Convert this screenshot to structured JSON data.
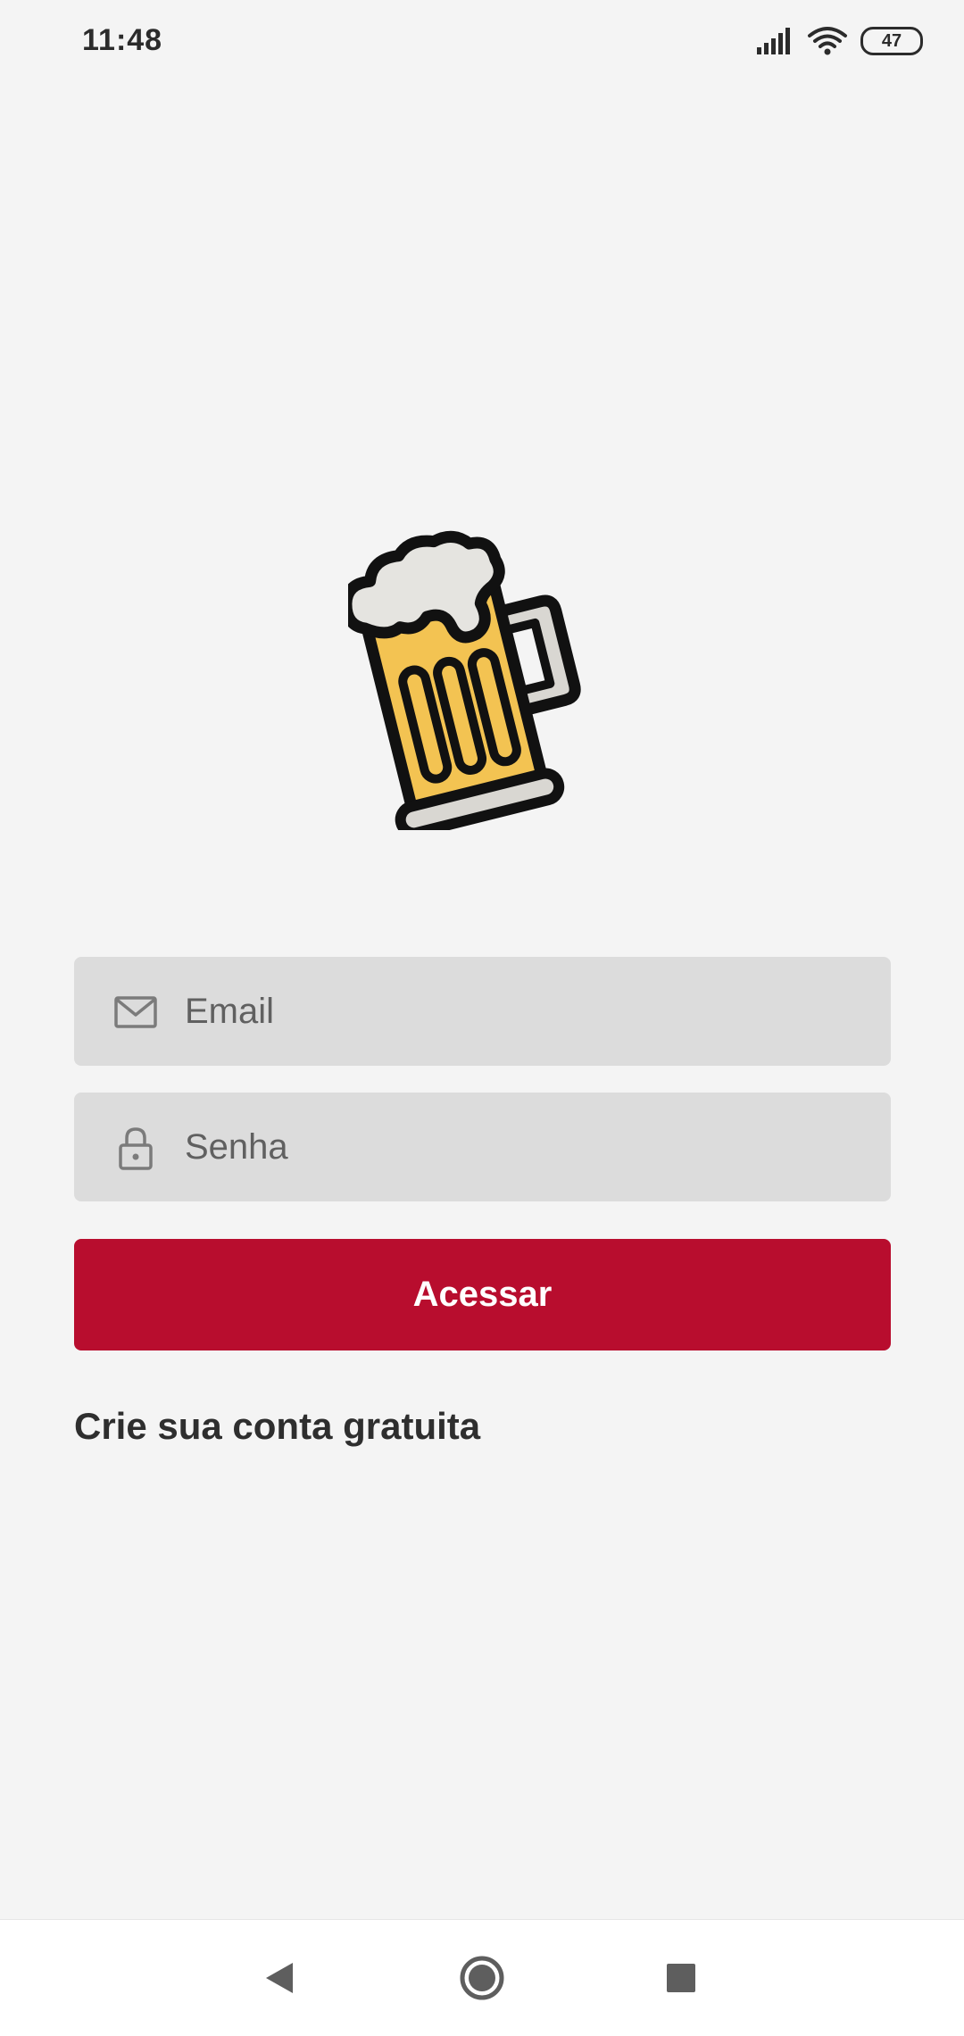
{
  "status_bar": {
    "time": "11:48",
    "battery": "47",
    "icons": [
      "signal-icon",
      "wifi-icon",
      "battery-icon"
    ]
  },
  "logo": {
    "icon": "beer-mug-icon"
  },
  "form": {
    "email": {
      "placeholder": "Email",
      "value": "",
      "icon": "mail-icon"
    },
    "password": {
      "placeholder": "Senha",
      "value": "",
      "icon": "lock-icon"
    },
    "submit_label": "Acessar",
    "signup_link": "Crie sua conta gratuita"
  },
  "colors": {
    "background": "#f4f4f4",
    "field_background": "#dcdcdc",
    "primary": "#b80d2e",
    "beer": "#f3c352",
    "foam": "#e5e4e0"
  },
  "nav": {
    "icons": [
      "back-icon",
      "home-icon",
      "recents-icon"
    ]
  }
}
